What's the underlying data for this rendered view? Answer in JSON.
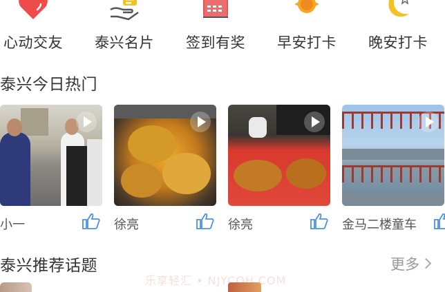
{
  "nav_icons": [
    {
      "label": "心动交友",
      "icon": "heart-icon",
      "color": "#ef4b4b"
    },
    {
      "label": "泰兴名片",
      "icon": "hand-card-icon",
      "color": "#555555"
    },
    {
      "label": "签到有奖",
      "icon": "calendar-icon",
      "color": "#e85454"
    },
    {
      "label": "早安打卡",
      "icon": "sun-icon",
      "color": "#f5a623"
    },
    {
      "label": "晚安打卡",
      "icon": "moon-icon",
      "color": "#f5c023"
    }
  ],
  "hot_section": {
    "title": "泰兴今日热门",
    "videos": [
      {
        "author": "小一",
        "icon": "play-icon"
      },
      {
        "author": "徐亮",
        "icon": "play-icon"
      },
      {
        "author": "徐亮",
        "icon": "play-icon"
      },
      {
        "author": "金马二楼童车",
        "icon": "play-icon"
      }
    ]
  },
  "topic_section": {
    "title": "泰兴推荐话题",
    "more_label": "更多"
  },
  "watermark": "乐享轻汇 • NJYCOH.COM"
}
